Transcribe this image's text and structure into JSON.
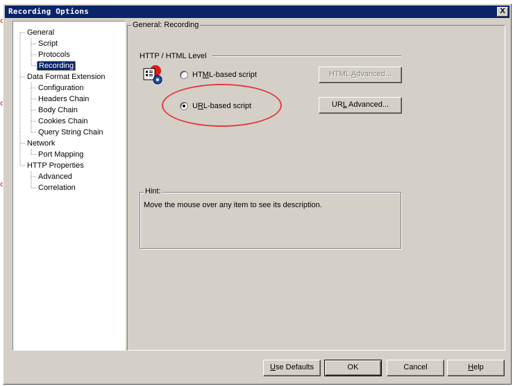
{
  "dialog": {
    "title": "Recording Options",
    "close_label": "X"
  },
  "tree": {
    "items": [
      {
        "label": "General",
        "level": 0
      },
      {
        "label": "Script",
        "level": 1
      },
      {
        "label": "Protocols",
        "level": 1
      },
      {
        "label": "Recording",
        "level": 1,
        "selected": true
      },
      {
        "label": "Data Format Extension",
        "level": 0
      },
      {
        "label": "Configuration",
        "level": 1
      },
      {
        "label": "Headers Chain",
        "level": 1
      },
      {
        "label": "Body Chain",
        "level": 1
      },
      {
        "label": "Cookies Chain",
        "level": 1
      },
      {
        "label": "Query String Chain",
        "level": 1
      },
      {
        "label": "Network",
        "level": 0
      },
      {
        "label": "Port Mapping",
        "level": 1
      },
      {
        "label": "HTTP Properties",
        "level": 0
      },
      {
        "label": "Advanced",
        "level": 1
      },
      {
        "label": "Correlation",
        "level": 1
      }
    ]
  },
  "page": {
    "title": "General: Recording",
    "level_group": {
      "label": "HTTP / HTML Level",
      "icon": "html-recording-icon",
      "options": [
        {
          "label_pre": "HT",
          "label_key": "M",
          "label_post": "L-based script",
          "checked": false
        },
        {
          "label_pre": "U",
          "label_key": "R",
          "label_post": "L-based script",
          "checked": true
        }
      ],
      "html_advanced_button": {
        "pre": "HTML ",
        "key": "A",
        "post": "dvanced..."
      },
      "url_advanced_button": {
        "pre": "UR",
        "key": "L",
        "post": " Advanced..."
      }
    },
    "hint": {
      "label": "Hint:",
      "text": "Move the mouse over any item to see its description."
    }
  },
  "footer": {
    "use_defaults": {
      "key": "U",
      "post": "se Defaults"
    },
    "ok": "OK",
    "cancel": "Cancel",
    "help": {
      "key": "H",
      "post": "elp"
    }
  },
  "annotation": {
    "color": "#e23b3b"
  }
}
